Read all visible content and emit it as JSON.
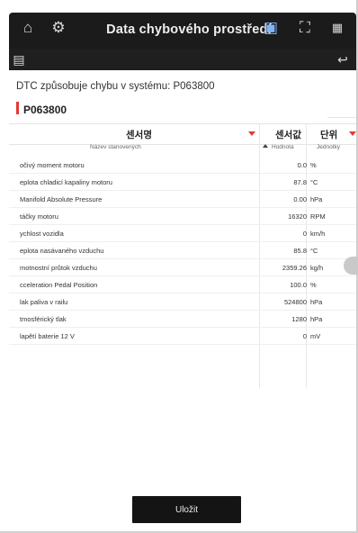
{
  "header": {
    "title": "Data chybového prostředí",
    "icons": [
      "home-icon",
      "diagnostic-icon",
      "car-scan-icon",
      "fullscreen-icon",
      "grid-icon",
      "screen-icon",
      "back-icon"
    ]
  },
  "system_line": "DTC způsobuje chybu v systému: P063800",
  "dtc_code": "P063800",
  "table": {
    "headers": {
      "name": "센서명",
      "value": "센서값",
      "unit": "단위"
    },
    "subheaders": {
      "name": "Název stanovených",
      "value": "Hodnota",
      "unit": "Jednotky"
    },
    "rows": [
      {
        "name": "očivý moment motoru",
        "value": "0.0",
        "unit": "%"
      },
      {
        "name": "eplota chladicí kapaliny motoru",
        "value": "87.8",
        "unit": "°C"
      },
      {
        "name": "Manifold Absolute Pressure",
        "value": "0.00",
        "unit": "hPa"
      },
      {
        "name": "táčky motoru",
        "value": "16320",
        "unit": "RPM"
      },
      {
        "name": "ychlost vozidla",
        "value": "0",
        "unit": "km/h"
      },
      {
        "name": "eplota nasávaného vzduchu",
        "value": "85.8",
        "unit": "°C"
      },
      {
        "name": "motnostní průtok vzduchu",
        "value": "2359.26",
        "unit": "kg/h"
      },
      {
        "name": "cceleration Pedal Position",
        "value": "100.0",
        "unit": "%"
      },
      {
        "name": "lak paliva v railu",
        "value": "524800",
        "unit": "hPa"
      },
      {
        "name": "tmosférický tlak",
        "value": "1280",
        "unit": "hPa"
      },
      {
        "name": "lapětí baterie 12 V",
        "value": "0",
        "unit": "mV"
      }
    ]
  },
  "save_label": "Uložit",
  "accent_color": "#e53935"
}
